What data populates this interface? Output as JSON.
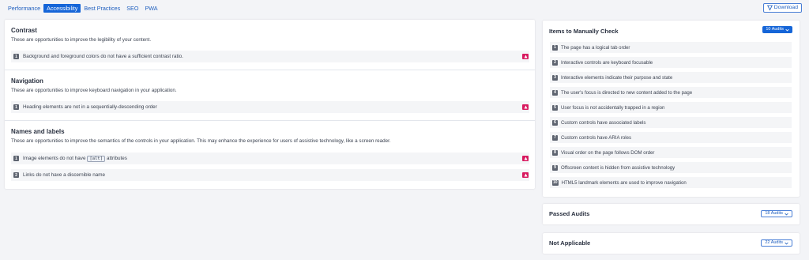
{
  "tabs": [
    {
      "label": "Performance",
      "active": false
    },
    {
      "label": "Accessibility",
      "active": true
    },
    {
      "label": "Best Practices",
      "active": false
    },
    {
      "label": "SEO",
      "active": false
    },
    {
      "label": "PWA",
      "active": false
    }
  ],
  "download_label": "Download",
  "sections": {
    "contrast": {
      "title": "Contrast",
      "desc": "These are opportunities to improve the legibility of your content.",
      "items": [
        {
          "num": "1",
          "text": "Background and foreground colors do not have a sufficient contrast ratio."
        }
      ]
    },
    "navigation": {
      "title": "Navigation",
      "desc": "These are opportunities to improve keyboard navigation in your application.",
      "items": [
        {
          "num": "1",
          "text": "Heading elements are not in a sequentially-descending order"
        }
      ]
    },
    "names": {
      "title": "Names and labels",
      "desc": "These are opportunities to improve the semantics of the controls in your application. This may enhance the experience for users of assistive technology, like a screen reader.",
      "items": [
        {
          "num": "1",
          "text_before": "Image elements do not have",
          "code": "[alt]",
          "text_after": "attributes"
        },
        {
          "num": "2",
          "text": "Links do not have a discernible name"
        }
      ]
    }
  },
  "manual": {
    "title": "Items to Manually Check",
    "badge": "10 Audits",
    "items": [
      {
        "num": "1",
        "text": "The page has a logical tab order"
      },
      {
        "num": "2",
        "text": "Interactive controls are keyboard focusable"
      },
      {
        "num": "3",
        "text": "Interactive elements indicate their purpose and state"
      },
      {
        "num": "4",
        "text": "The user's focus is directed to new content added to the page"
      },
      {
        "num": "5",
        "text": "User focus is not accidentally trapped in a region"
      },
      {
        "num": "6",
        "text": "Custom controls have associated labels"
      },
      {
        "num": "7",
        "text": "Custom controls have ARIA roles"
      },
      {
        "num": "8",
        "text": "Visual order on the page follows DOM order"
      },
      {
        "num": "9",
        "text": "Offscreen content is hidden from assistive technology"
      },
      {
        "num": "10",
        "text": "HTML5 landmark elements are used to improve navigation"
      }
    ]
  },
  "passed": {
    "title": "Passed Audits",
    "badge": "18 Audits"
  },
  "not_applicable": {
    "title": "Not Applicable",
    "badge": "22 Audits"
  },
  "colors": {
    "accent": "#1565d8",
    "warn": "#d81b60"
  },
  "icons": {
    "download": "download-icon",
    "warn": "warning-icon",
    "chevron": "chevron-down-icon"
  }
}
